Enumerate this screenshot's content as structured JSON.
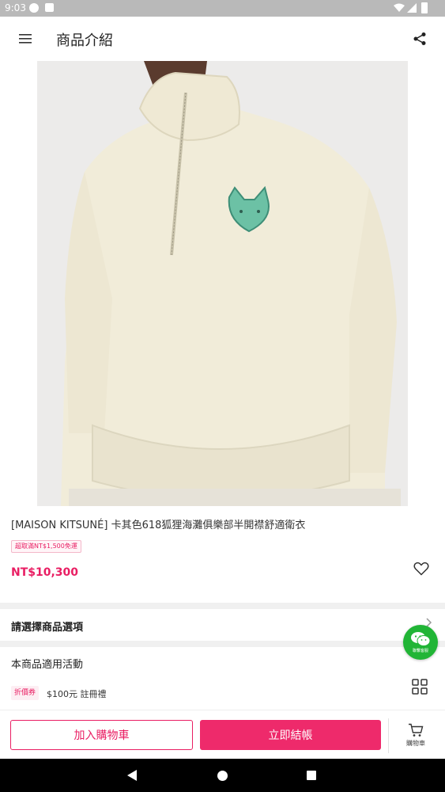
{
  "status_bar": {
    "time": "9:03"
  },
  "app_bar": {
    "title": "商品介紹"
  },
  "product": {
    "name": "[MAISON KITSUNÉ]  卡其色618狐狸海灘俱樂部半開襟舒適衛衣",
    "promo_badge": "超取滿NT$1,500免運",
    "price": "NT$10,300"
  },
  "options": {
    "label": "請選擇商品選項"
  },
  "activities": {
    "title": "本商品適用活動",
    "coupon_badge": "折價券",
    "coupon_text": "$100元 註冊禮"
  },
  "wechat_fab": {
    "label": "聯繫客服"
  },
  "bottom_bar": {
    "add_to_cart": "加入購物車",
    "checkout": "立即結帳",
    "cart_label": "購物車"
  },
  "colors": {
    "accent": "#e91e63",
    "checkout_bg": "#ee2a6b",
    "wechat_green": "#21b536",
    "statusbar_bg": "#b9b9b9"
  }
}
